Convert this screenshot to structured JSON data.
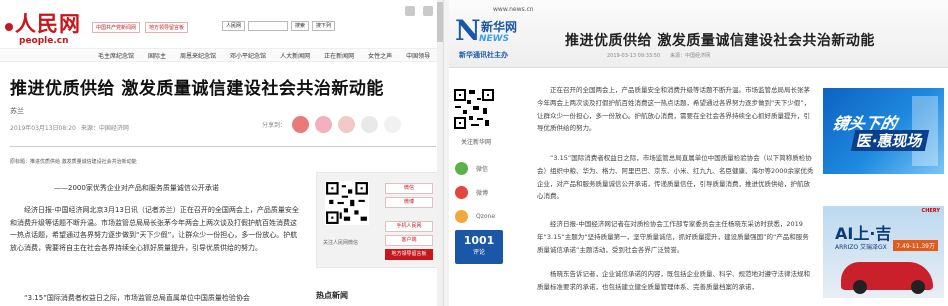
{
  "left": {
    "logo": {
      "cn": "人民网",
      "en": "people.cn"
    },
    "top_links": [
      "中国共产党新闻网",
      "地方领导留言板"
    ],
    "search": {
      "select1": "人民网",
      "select2": "搜索",
      "select3": "搜下列"
    },
    "nav": [
      "毛主席纪念馆",
      "国际主",
      "周恩来纪念馆",
      "邓小平纪念馆",
      "人大新闻网",
      "正在新闻网",
      "女性之声",
      "中国领导"
    ],
    "title": "推进优质供给 激发质量诚信建设社会共治新动能",
    "author": "苏兰",
    "meta": {
      "date": "2019年03月13日08:20",
      "source": "来源：中国经济网"
    },
    "share_label": "分享到：",
    "share_icons": [
      {
        "name": "weibo",
        "color": "#e77a7a"
      },
      {
        "name": "wechat",
        "color": "#f3b1bd"
      },
      {
        "name": "qzone",
        "color": "#f3c8c8"
      },
      {
        "name": "people",
        "color": "#e9e9e9"
      },
      {
        "name": "more",
        "color": "#f1f1f1"
      }
    ],
    "crumb": "原标题：推进优质供给 激发质量诚信建设社会共治新动能",
    "subtitle": "——2000家优秀企业对产品和服务质量诚信公开承诺",
    "paragraph1": "经济日报-中国经济网北京3月13日讯（记者苏兰）正在召开的全国两会上，产品质量安全和消费升级等话题不断升温。市场监管总局局长张茅今年两会上两次谈及打假护航百姓消费这一热点话题，希望通过各界努力逐步做到“天下少假”，让群众少一份担心，多一份放心。护航放心消费，需要将自主在社会各界持续全心抓好质量提升，引导优质供给的努力。",
    "paragraph2": "“3.15”国际消费者权益日之际，市场监管总局直属单位中国质量检验协会",
    "side": {
      "follow": "关注人民网微信",
      "buttons": [
        "微信",
        "微博",
        "手机人民网",
        "客户端",
        "地方领导留言板"
      ]
    },
    "bottom_heading": "热点新闻"
  },
  "right": {
    "logo": {
      "url": "www.news.cn",
      "cn": "新华网",
      "news": "NEWS",
      "slogan": "新华通讯社主办"
    },
    "title": "推进优质供给 激发质量诚信建设社会共治新动能",
    "meta": "2019-03-13 09:33:50　　来源：中国经济网",
    "follow": "关注新华网",
    "share": [
      {
        "label": "微信",
        "color": "#5ab34a"
      },
      {
        "label": "微博",
        "color": "#e2463a"
      },
      {
        "label": "Qzone",
        "color": "#f2a73c"
      }
    ],
    "count": {
      "number": "1001",
      "label": "评论"
    },
    "p1": "正在召开的全国两会上，产品质量安全和消费升级等话题不断升温。市场监管总局局长张茅今年两会上两次谈及打假护航百姓消费这一热点话题，希望通过各界努力逐步做到“天下少假”，让群众少一份担心，多一份放心。护航放心消费，需要在全社会各界持续全心抓好质量提升，引导优质供给的努力。",
    "p2": "“3.15”国际消费者权益日之际，市场监管总局直属单位中国质量检验协会（以下简称质检协会）组织中粮、华为、格力、阿里巴巴、京东、小米、红九九、名臣健康、海尔等2000余家优秀企业，对产品和服务质量诚信公开承诺，传递质量信任，引导质量消费，推进优质供给，护航放心消费。",
    "p3": "经济日报-中国经济网记者在对质检协会工作部专家委员会主任杨晓东采访时获悉，2019年“3.15”主题为“坚持质量第一，坚守质量诚信，抓好质量提升，建设质量强国”的“产品和服务质量诚信承诺”主题活动，受到社会各界广泛赞誉。",
    "p4": "杨晓东告诉记者，企业诚信承诺的内容，既包括企业质量、科学、规范地对遵守法律法规和质量标准要求的承诺，也包括建立健全质量管理体系、完善质量档案的承诺，",
    "ad1": {
      "line1": "镜头下的",
      "line2": "医·惠现场"
    },
    "ad2": {
      "brand": "CHERY",
      "headline": "AI上·吉",
      "model": "ARRIZO 艾瑞泽GX",
      "date": "7.49-11.39万"
    }
  }
}
